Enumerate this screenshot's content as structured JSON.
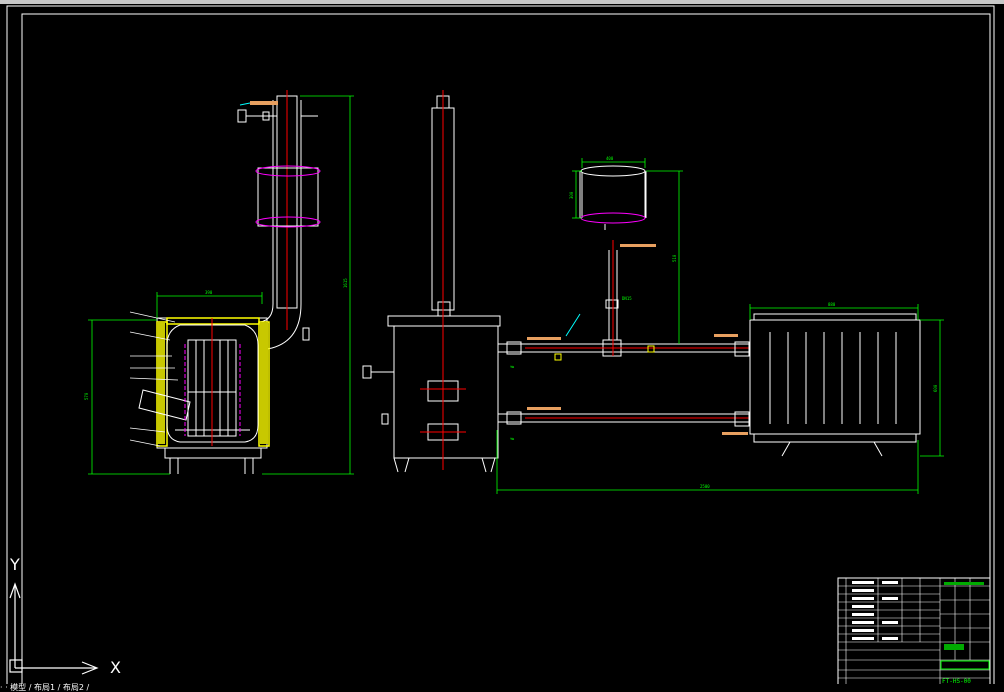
{
  "colors": {
    "background": "#000000",
    "dimension": "#00ff00",
    "outline": "#ffffff",
    "centerline": "#ff0000",
    "insulation": "#ffff00",
    "hidden": "#ff00ff",
    "leader": "#00ffff",
    "label_tag": "#e8a060"
  },
  "ucs": {
    "y_label": "Y",
    "x_label": "X"
  },
  "drawing": {
    "left_view": {
      "dims": {
        "width": "390",
        "height": "570",
        "overall_height": "1615"
      }
    },
    "right_view": {
      "dims": {
        "tank_width": "400",
        "tank_height": "300",
        "riser_height": "510",
        "pipe_label": "DN15",
        "overall_length": "2500",
        "radiator_width": "880",
        "radiator_height": "600"
      }
    },
    "title_block": {
      "drawing_no": "FT-HS-00"
    }
  },
  "status_text": "· · 模型 / 布局1 / 布局2 /"
}
